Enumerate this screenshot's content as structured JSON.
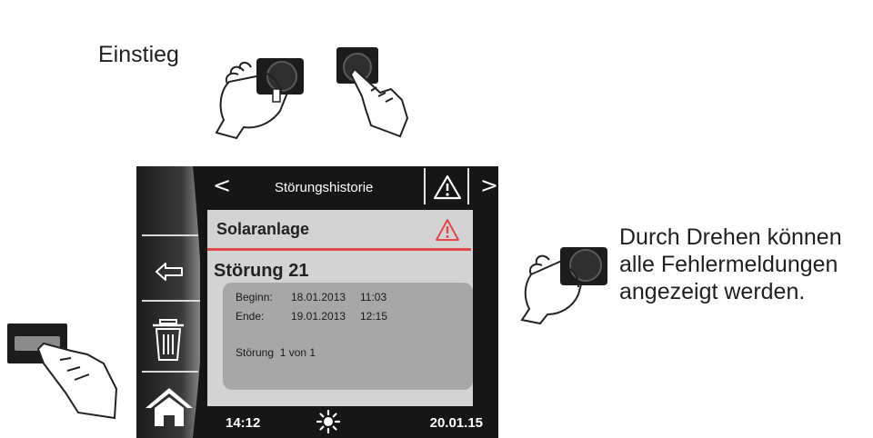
{
  "captions": {
    "entry": "Einstieg",
    "hint_lines": [
      "Durch Drehen können",
      "alle Fehlermeldungen",
      "angezeigt werden."
    ]
  },
  "screen": {
    "title": "Störungshistorie",
    "nav_prev": "<",
    "nav_next": ">",
    "category": "Solaranlage",
    "error_title": "Störung 21",
    "details": {
      "begin_label": "Beginn:",
      "begin_date": "18.01.2013",
      "begin_time": "11:03",
      "end_label": "Ende:",
      "end_date": "19.01.2013",
      "end_time": "12:15",
      "count": "Störung  1 von 1"
    },
    "status": {
      "time": "14:12",
      "date": "20.01.15",
      "weather_icon": "sun-icon"
    },
    "sidebar_icons": [
      "back-arrow-icon",
      "trash-icon",
      "home-icon"
    ],
    "colors": {
      "alert_red": "#e0484a",
      "panel": "#d3d3d3",
      "detail_panel": "#a7a7a7",
      "frame": "#161616"
    }
  }
}
